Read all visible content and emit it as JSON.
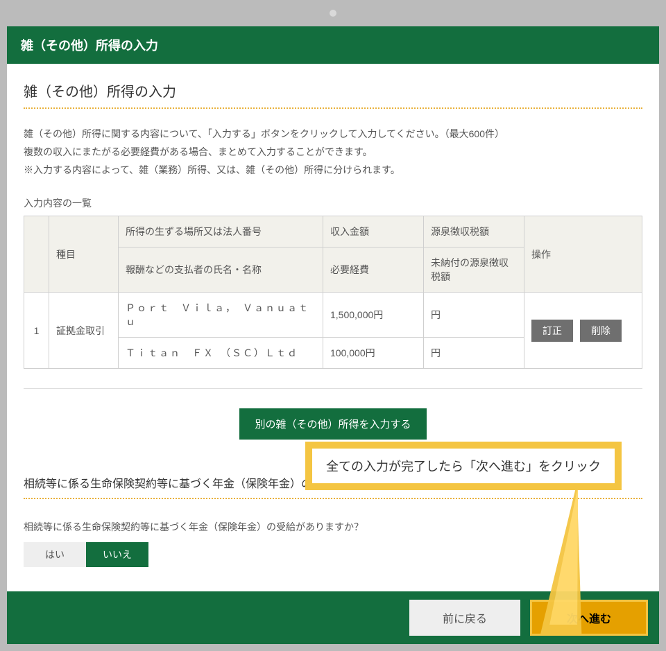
{
  "header": {
    "title": "雑（その他）所得の入力"
  },
  "section1": {
    "title": "雑（その他）所得の入力",
    "desc1": "雑（その他）所得に関する内容について、「入力する」ボタンをクリックして入力してください。（最大600件）",
    "desc2": "複数の収入にまたがる必要経費がある場合、まとめて入力することができます。",
    "desc3": "※入力する内容によって、雑（業務）所得、又は、雑（その他）所得に分けられます。",
    "list_caption": "入力内容の一覧"
  },
  "table": {
    "headers": {
      "kind": "種目",
      "place": "所得の生ずる場所又は法人番号",
      "payer": "報酬などの支払者の氏名・名称",
      "income": "収入金額",
      "expense": "必要経費",
      "withholding": "源泉徴収税額",
      "unpaid_withholding": "未納付の源泉徴収税額",
      "ops": "操作"
    },
    "rows": [
      {
        "idx": "1",
        "kind": "証拠金取引",
        "place": "Ｐｏｒｔ　Ｖｉｌａ，　Ｖａｎｕａｔｕ",
        "payer": "Ｔｉｔａｎ　ＦＸ　（ＳＣ）Ｌｔｄ",
        "income": "1,500,000円",
        "expense": "100,000円",
        "withholding": "円",
        "unpaid_withholding": "円"
      }
    ]
  },
  "buttons": {
    "edit": "訂正",
    "delete": "削除",
    "add_other": "別の雑（その他）所得を入力する",
    "yes": "はい",
    "no": "いいえ",
    "back": "前に戻る",
    "next": "次へ進む"
  },
  "callout": {
    "text": "全ての入力が完了したら「次へ進む」をクリック"
  },
  "section2": {
    "title": "相続等に係る生命保険契約等に基づく年金（保険年金）の入力",
    "question": "相続等に係る生命保険契約等に基づく年金（保険年金）の受給がありますか？"
  }
}
